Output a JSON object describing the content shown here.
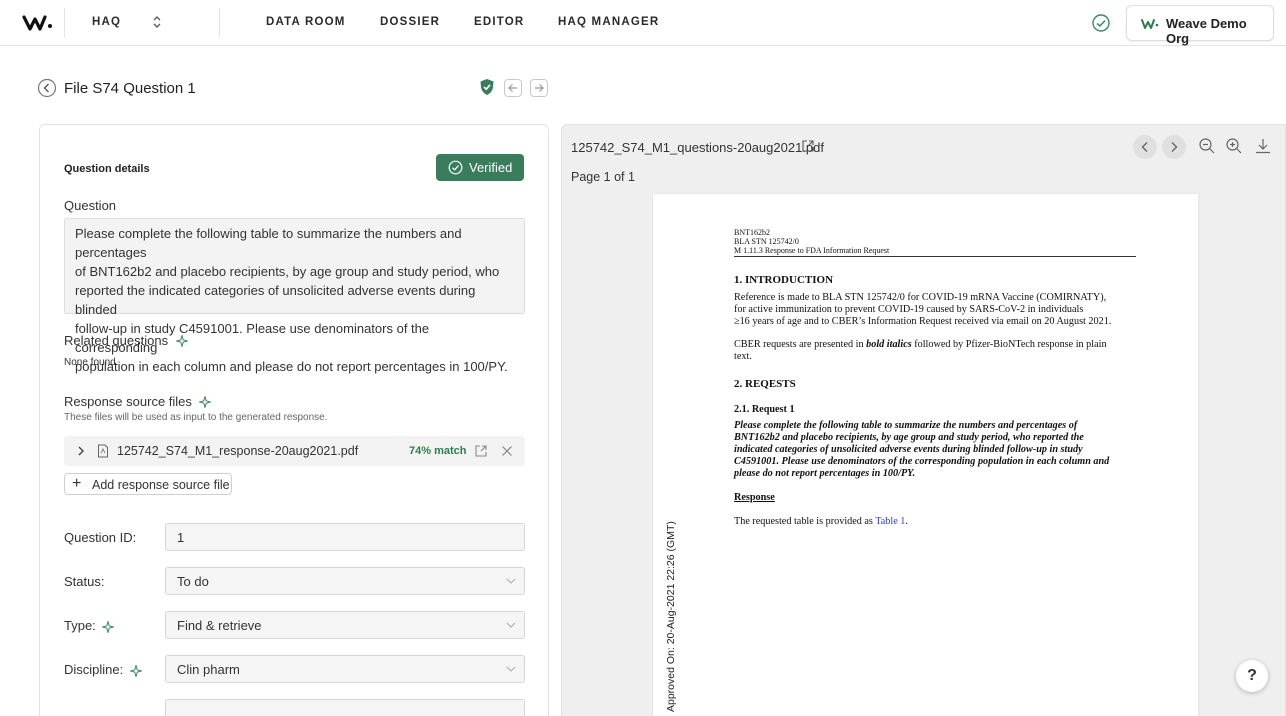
{
  "nav": {
    "items": [
      "HAQ",
      "DATA ROOM",
      "DOSSIER",
      "EDITOR",
      "HAQ MANAGER"
    ],
    "org_name": "Weave Demo Org"
  },
  "page": {
    "title": "File S74 Question 1"
  },
  "details": {
    "section_title": "Question details",
    "verified_label": "Verified",
    "question_label": "Question",
    "question_lines": [
      "Please complete the following table to summarize the numbers and percentages",
      "of BNT162b2 and placebo recipients, by age group and study period, who",
      "reported the indicated categories of unsolicited adverse events during blinded",
      "follow-up in study C4591001. Please use denominators of the corresponding",
      "population in each column and please do not report percentages in 100/PY."
    ],
    "related_label": "Related questions",
    "related_value": "None found.",
    "sources_label": "Response source files",
    "sources_help": "These files will be used as input to the generated response.",
    "source_file": {
      "name": "125742_S74_M1_response-20aug2021.pdf",
      "match": "74% match"
    },
    "add_source_label": "Add response source file",
    "fields": [
      {
        "label": "Question ID:",
        "value": "1"
      },
      {
        "label": "Status:",
        "value": "To do"
      },
      {
        "label": "Type:",
        "value": "Find & retrieve"
      },
      {
        "label": "Discipline:",
        "value": "Clin pharm"
      }
    ]
  },
  "viewer": {
    "file_name": "125742_S74_M1_questions-20aug2021.pdf",
    "page_count": "Page 1 of 1",
    "doc": {
      "header": [
        "BNT162b2",
        "BLA STN 125742/0",
        "M 1.11.3 Response to FDA Information Request"
      ],
      "intro_heading": "1. INTRODUCTION",
      "intro_lines": [
        "Reference is made to BLA STN 125742/0 for COVID-19 mRNA Vaccine (COMIRNATY),",
        "for active immunization to prevent COVID-19 caused by SARS-CoV-2 in individuals",
        "≥16 years of age and to CBER’s Information Request received via email on 20 August 2021."
      ],
      "cber_pre": "CBER requests are presented in ",
      "cber_em": "bold italics",
      "cber_post": " followed by Pfizer-BioNTech response in plain",
      "cber_line2": "text.",
      "requests_heading": "2. REQESTS",
      "request1_heading": "2.1. Request 1",
      "request1_lines": [
        "Please complete the following table to summarize the numbers and percentages of",
        "BNT162b2 and placebo recipients, by age group and study period, who reported the",
        "indicated categories of unsolicited adverse events during blinded follow-up in study",
        "C4591001. Please use denominators of the corresponding  population in each column and",
        "please do not report percentages in 100/PY."
      ],
      "response_heading": "Response",
      "response_pre": "The requested table is provided as ",
      "response_link": "Table 1",
      "response_post": ".",
      "stamp": "Approved On: 20-Aug-2021 22:26 (GMT)"
    }
  },
  "help_label": "?",
  "colors": {
    "accent_green": "#3a7d5d",
    "match_green": "#2e7d4f",
    "link_blue": "#2a3fbf"
  }
}
